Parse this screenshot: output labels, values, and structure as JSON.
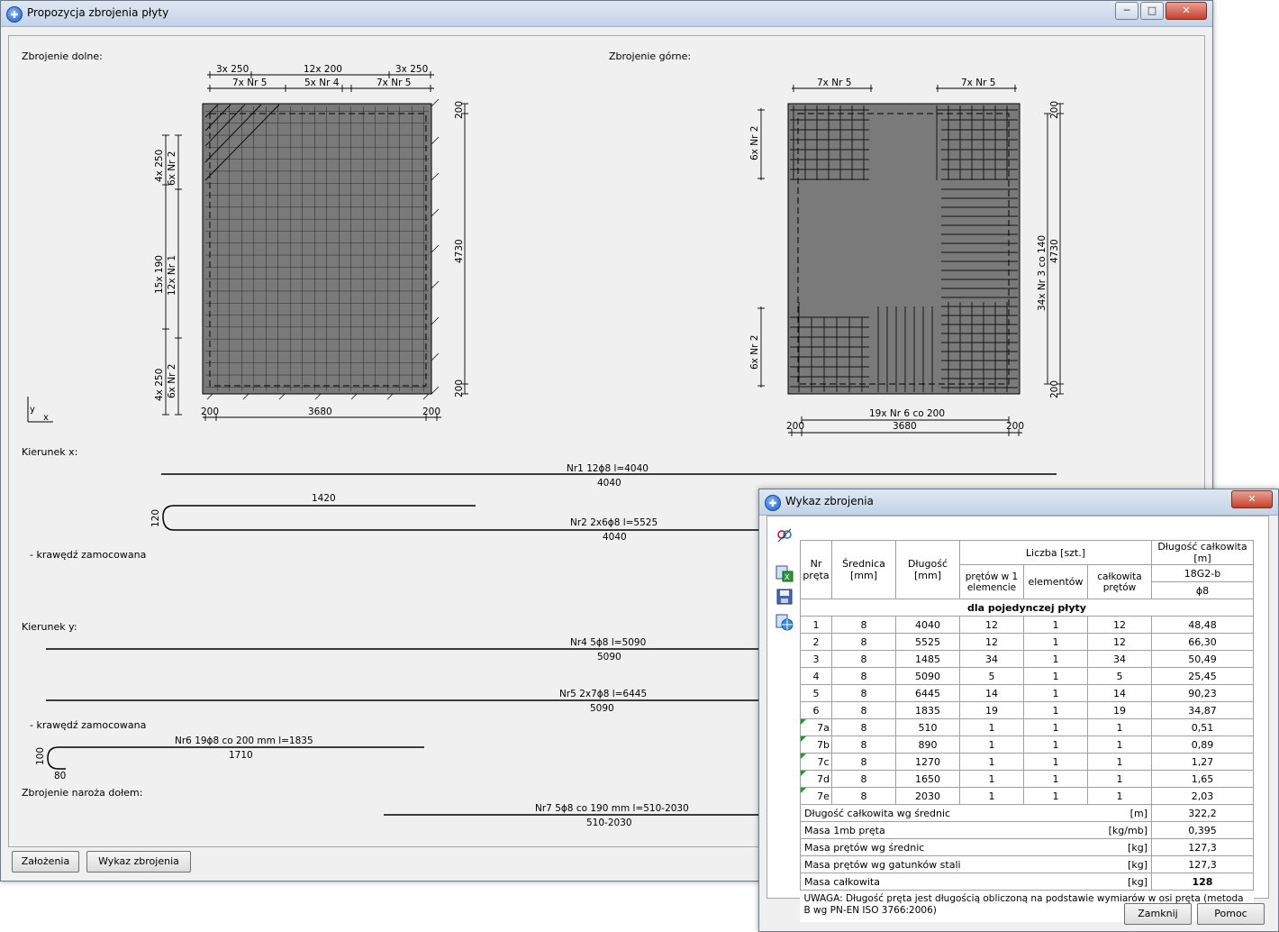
{
  "main_window": {
    "title": "Propozycja zbrojenia płyty",
    "bottom_label": "Zbrojenie dolne:",
    "top_label": "Zbrojenie górne:",
    "dir_x_label": "Kierunek x:",
    "dir_y_label": "Kierunek y:",
    "fixed_edge_1": "- krawędź zamocowana",
    "fixed_edge_2": "- krawędź zamocowana",
    "corner_label": "Zbrojenie naroża dołem:",
    "axis_y": "y",
    "axis_x": "x",
    "buttons": {
      "assumptions": "Założenia",
      "schedule": "Wykaz zbrojenia"
    }
  },
  "bottom_drawing": {
    "top_spacing": [
      "3x 250",
      "12x 200",
      "3x 250"
    ],
    "top_bars": [
      "7x Nr 5",
      "5x Nr 4",
      "7x Nr 5"
    ],
    "left_spacing": [
      "4x 250",
      "15x 190",
      "4x 250"
    ],
    "left_bars": [
      "6x Nr 2",
      "12x Nr 1",
      "6x Nr 2"
    ],
    "right_dims": [
      "200",
      "4730",
      "200"
    ],
    "bottom_dims": [
      "200",
      "3680",
      "200"
    ]
  },
  "top_drawing": {
    "top_bars": [
      "7x Nr 5",
      "7x Nr 5"
    ],
    "left_bars": [
      "6x Nr 2",
      "6x Nr 2"
    ],
    "right_bars": "34x Nr 3 co 140",
    "right_dims": [
      "200",
      "4730",
      "200"
    ],
    "bottom_bars": "19x Nr 6 co 200",
    "bottom_dims": [
      "200",
      "3680",
      "200"
    ]
  },
  "bar_shapes": {
    "nr1": {
      "label": "Nr1   12ϕ8  l=4040",
      "length": "4040"
    },
    "nr2": {
      "label": "Nr2   2x6ϕ8  l=5525",
      "length": "4040",
      "hook_len": "1420",
      "hook_height": "120"
    },
    "nr4": {
      "label": "Nr4   5ϕ8  l=5090",
      "length": "5090"
    },
    "nr5": {
      "label": "Nr5   2x7ϕ8  l=6445",
      "length": "5090"
    },
    "nr6": {
      "label": "Nr6   19ϕ8 co 200 mm  l=1835",
      "length": "1710",
      "hook_height": "100",
      "hook_len": "80"
    },
    "nr7": {
      "label": "Nr7   5ϕ8 co 190 mm  l=510-2030",
      "length": "510-2030"
    }
  },
  "schedule_window": {
    "title": "Wykaz zbrojenia",
    "headers": {
      "nr": "Nr pręta",
      "diameter": "Średnica [mm]",
      "length": "Długość [mm]",
      "count": "Liczba [szt.]",
      "per_element": "prętów w 1 elemencie",
      "elements": "elementów",
      "total_bars": "całkowita prętów",
      "total_length": "Długość całkowita [m]",
      "steel": "18G2-b",
      "phi": "ϕ8"
    },
    "section": "dla pojedynczej płyty",
    "rows": [
      {
        "nr": "1",
        "d": "8",
        "len": "4040",
        "per": "12",
        "el": "1",
        "tot": "12",
        "m": "48,48"
      },
      {
        "nr": "2",
        "d": "8",
        "len": "5525",
        "per": "12",
        "el": "1",
        "tot": "12",
        "m": "66,30"
      },
      {
        "nr": "3",
        "d": "8",
        "len": "1485",
        "per": "34",
        "el": "1",
        "tot": "34",
        "m": "50,49"
      },
      {
        "nr": "4",
        "d": "8",
        "len": "5090",
        "per": "5",
        "el": "1",
        "tot": "5",
        "m": "25,45"
      },
      {
        "nr": "5",
        "d": "8",
        "len": "6445",
        "per": "14",
        "el": "1",
        "tot": "14",
        "m": "90,23"
      },
      {
        "nr": "6",
        "d": "8",
        "len": "1835",
        "per": "19",
        "el": "1",
        "tot": "19",
        "m": "34,87"
      },
      {
        "nr": "7a",
        "d": "8",
        "len": "510",
        "per": "1",
        "el": "1",
        "tot": "1",
        "m": "0,51"
      },
      {
        "nr": "7b",
        "d": "8",
        "len": "890",
        "per": "1",
        "el": "1",
        "tot": "1",
        "m": "0,89"
      },
      {
        "nr": "7c",
        "d": "8",
        "len": "1270",
        "per": "1",
        "el": "1",
        "tot": "1",
        "m": "1,27"
      },
      {
        "nr": "7d",
        "d": "8",
        "len": "1650",
        "per": "1",
        "el": "1",
        "tot": "1",
        "m": "1,65"
      },
      {
        "nr": "7e",
        "d": "8",
        "len": "2030",
        "per": "1",
        "el": "1",
        "tot": "1",
        "m": "2,03"
      }
    ],
    "summary": [
      {
        "label": "Długość całkowita wg średnic",
        "unit": "[m]",
        "value": "322,2"
      },
      {
        "label": "Masa  1mb pręta",
        "unit": "[kg/mb]",
        "value": "0,395"
      },
      {
        "label": "Masa prętów wg średnic",
        "unit": "[kg]",
        "value": "127,3"
      },
      {
        "label": "Masa prętów wg gatunków stali",
        "unit": "[kg]",
        "value": "127,3"
      },
      {
        "label": "Masa całkowita",
        "unit": "[kg]",
        "value": "128"
      }
    ],
    "note": "UWAGA: Długość pręta jest długością obliczoną na podstawie wymiarów w osi pręta (metoda B wg PN-EN ISO 3766:2006)",
    "buttons": {
      "close": "Zamknij",
      "help": "Pomoc"
    }
  }
}
